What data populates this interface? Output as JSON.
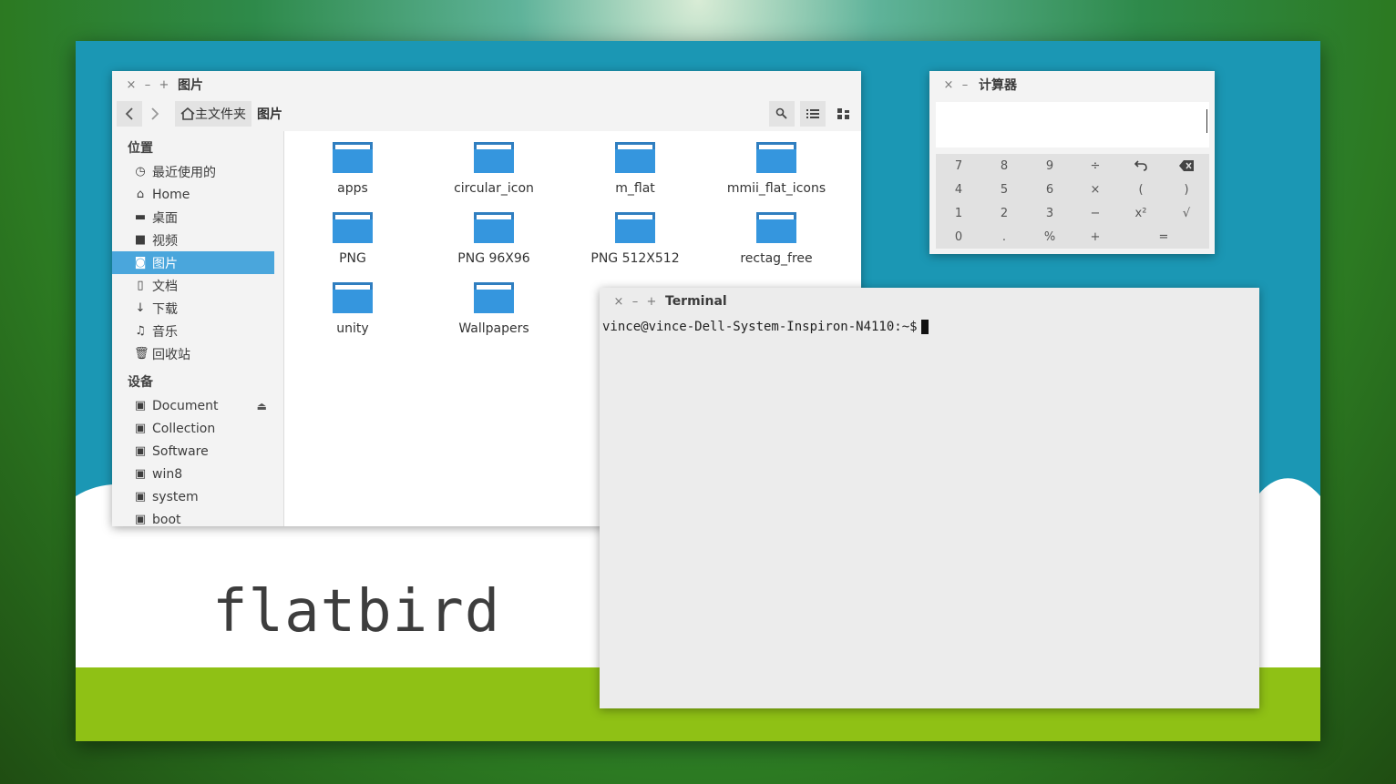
{
  "desktop": {
    "logo_text": "flatbird"
  },
  "file_manager": {
    "window_title": "图片",
    "controls": {
      "close": "×",
      "minimize": "–",
      "maximize": "+"
    },
    "nav": {
      "back": "<",
      "forward": ">"
    },
    "breadcrumb": [
      {
        "label": "主文件夹",
        "icon": "home-icon"
      },
      {
        "label": "图片"
      }
    ],
    "toolbar": {
      "search_icon": "search-icon",
      "list_view_icon": "list-view-icon",
      "grid_view_icon": "grid-view-icon"
    },
    "sidebar": {
      "places_header": "位置",
      "places": [
        {
          "label": "最近使用的",
          "icon": "clock-icon"
        },
        {
          "label": "Home",
          "icon": "home-icon"
        },
        {
          "label": "桌面",
          "icon": "folder-icon"
        },
        {
          "label": "视频",
          "icon": "video-icon"
        },
        {
          "label": "图片",
          "icon": "camera-icon",
          "selected": true
        },
        {
          "label": "文档",
          "icon": "document-icon"
        },
        {
          "label": "下载",
          "icon": "download-icon"
        },
        {
          "label": "音乐",
          "icon": "music-icon"
        },
        {
          "label": "回收站",
          "icon": "trash-icon"
        }
      ],
      "devices_header": "设备",
      "devices": [
        {
          "label": "Document",
          "icon": "drive-icon",
          "eject": true
        },
        {
          "label": "Collection",
          "icon": "drive-icon"
        },
        {
          "label": "Software",
          "icon": "drive-icon"
        },
        {
          "label": "win8",
          "icon": "drive-icon"
        },
        {
          "label": "system",
          "icon": "drive-icon"
        },
        {
          "label": "boot",
          "icon": "drive-icon"
        }
      ]
    },
    "folders": [
      "apps",
      "circular_icon",
      "m_flat",
      "mmii_flat_icons",
      "PNG",
      "PNG 96X96",
      "PNG 512X512",
      "rectag_free",
      "unity",
      "Wallpapers"
    ],
    "colors": {
      "selection": "#4aa6dc",
      "folder": "#3596de"
    }
  },
  "calculator": {
    "window_title": "计算器",
    "controls": {
      "close": "×",
      "minimize": "–"
    },
    "display_value": "",
    "keys": [
      "7",
      "8",
      "9",
      "÷",
      "↶",
      "⌫",
      "4",
      "5",
      "6",
      "×",
      "(",
      ")",
      "1",
      "2",
      "3",
      "−",
      "x²",
      "√",
      "0",
      ".",
      "%",
      "+",
      "="
    ]
  },
  "terminal": {
    "window_title": "Terminal",
    "controls": {
      "close": "×",
      "minimize": "–",
      "maximize": "+"
    },
    "prompt": "vince@vince-Dell-System-Inspiron-N4110:~$"
  }
}
